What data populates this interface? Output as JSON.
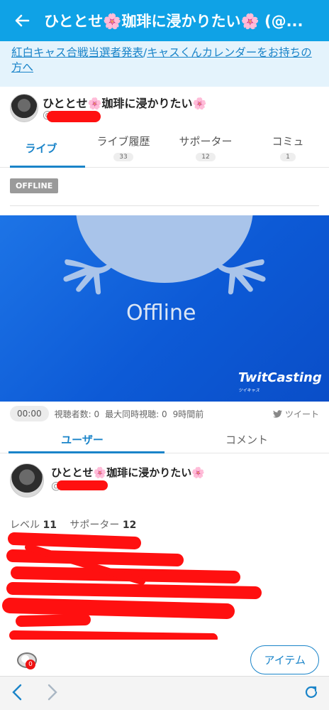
{
  "appbar": {
    "title": "ひととせ🌸珈琲に浸かりたい🌸 (@..."
  },
  "notice": {
    "link1": "紅白キャス合戦当選者発表",
    "sep": "/",
    "link2": "キャスくんカレンダーをお持ちの方へ"
  },
  "user": {
    "name": "ひととせ🌸珈琲に浸かりたい🌸",
    "handle": "@"
  },
  "tabs": [
    {
      "label": "ライブ",
      "count": ""
    },
    {
      "label": "ライブ履歴",
      "count": "33"
    },
    {
      "label": "サポーター",
      "count": "12"
    },
    {
      "label": "コミュ",
      "count": "1"
    }
  ],
  "status_badge": "OFFLINE",
  "player": {
    "offline_text": "Offline",
    "brand": "TwitCasting",
    "brand_small": "ツイキャス"
  },
  "stats": {
    "time": "00:00",
    "viewers": "視聴者数: 0",
    "max_viewers": "最大同時視聴: 0",
    "ago": "9時間前",
    "tweet": "ツイート"
  },
  "subtabs": {
    "user": "ユーザー",
    "comment": "コメント"
  },
  "profile": {
    "name": "ひととせ🌸珈琲に浸かりたい🌸",
    "handle": "@"
  },
  "level": {
    "level_label": "レベル",
    "level_value": "11",
    "supporter_label": "サポーター",
    "supporter_value": "12"
  },
  "bio": [
    "",
    "",
    "",
    "",
    "",
    "",
    ""
  ],
  "bottom": {
    "gift_count": "0",
    "item_button": "アイテム"
  },
  "colors": {
    "accent": "#0fa2e6",
    "link": "#1a84c9",
    "redaction": "#ff1010"
  }
}
